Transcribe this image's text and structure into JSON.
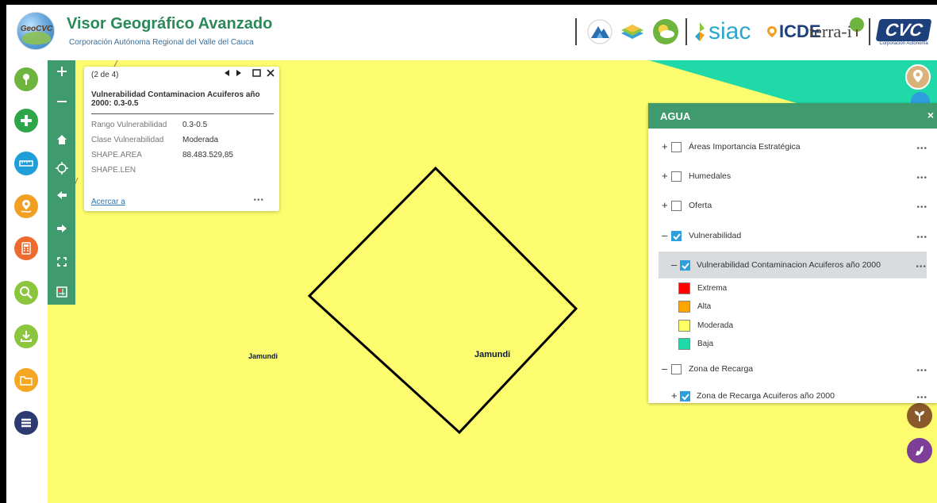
{
  "header": {
    "logo_text": "GeoCVC",
    "title": "Visor Geográfico Avanzado",
    "subtitle": "Corporación Autónoma Regional del Valle del Cauca",
    "partners": {
      "siac": "siac",
      "icde": "ICDE",
      "terrai": "terra-i",
      "cvc": "CVC"
    }
  },
  "left_tools": [
    {
      "name": "location-pin-icon",
      "color": "#6fb43f"
    },
    {
      "name": "add-icon",
      "color": "#2fa54a"
    },
    {
      "name": "ruler-icon",
      "color": "#1f9ed8"
    },
    {
      "name": "route-pin-icon",
      "color": "#f2a024"
    },
    {
      "name": "calculator-icon",
      "color": "#ee6b2f"
    },
    {
      "name": "search-icon",
      "color": "#8cc63f"
    },
    {
      "name": "download-icon",
      "color": "#8cc63f"
    },
    {
      "name": "folder-icon",
      "color": "#f5a623"
    },
    {
      "name": "menu-icon",
      "color": "#2d3a72"
    }
  ],
  "nav_tools": [
    "zoom-in",
    "zoom-out",
    "home",
    "locate",
    "back",
    "forward",
    "fullscreen",
    "layers"
  ],
  "popup": {
    "count": "(2 de 4)",
    "title": "Vulnerabilidad Contaminacion Acuiferos año 2000: 0.3-0.5",
    "attributes": [
      {
        "key": "Rango Vulnerabilidad",
        "value": "0.3-0.5"
      },
      {
        "key": "Clase Vulnerabilidad",
        "value": "Moderada"
      },
      {
        "key": "SHAPE.AREA",
        "value": "88.483.529,85"
      },
      {
        "key": "SHAPE.LEN",
        "value": ""
      }
    ],
    "zoom_link": "Acercar a",
    "more": "•••"
  },
  "map": {
    "labels": [
      "Jamundi",
      "Jamundi"
    ],
    "fill_color": "#fcfc6e",
    "teal_color": "#1fd9a8"
  },
  "agua_panel": {
    "title": "AGUA",
    "close": "×",
    "layers": [
      {
        "label": "Áreas Importancia Estratégica",
        "expand": "+",
        "checked": false
      },
      {
        "label": "Humedales",
        "expand": "+",
        "checked": false
      },
      {
        "label": "Oferta",
        "expand": "+",
        "checked": false
      },
      {
        "label": "Vulnerabilidad",
        "expand": "–",
        "checked": true
      },
      {
        "label": "Vulnerabilidad Contaminacion Acuiferos año 2000",
        "expand": "–",
        "checked": true
      },
      {
        "label": "Zona de Recarga",
        "expand": "–",
        "checked": false
      },
      {
        "label": "Zona de Recarga Acuiferos año 2000",
        "expand": "+",
        "checked": true
      }
    ],
    "legend": [
      {
        "label": "Extrema",
        "color": "#ff0000"
      },
      {
        "label": "Alta",
        "color": "#ffa500"
      },
      {
        "label": "Moderada",
        "color": "#ffff66"
      },
      {
        "label": "Baja",
        "color": "#1fd9a8"
      }
    ],
    "more": "•••"
  }
}
